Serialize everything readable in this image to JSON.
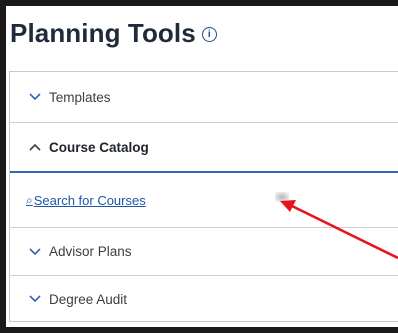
{
  "header": {
    "title": "Planning Tools",
    "info_icon": "info-icon"
  },
  "accordion": {
    "items": [
      {
        "label": "Templates",
        "state": "collapsed",
        "icon": "chevron-down-icon"
      },
      {
        "label": "Course Catalog",
        "state": "expanded",
        "icon": "chevron-up-icon"
      },
      {
        "label": "Advisor Plans",
        "state": "collapsed",
        "icon": "chevron-down-icon"
      },
      {
        "label": "Degree Audit",
        "state": "collapsed",
        "icon": "chevron-down-icon"
      }
    ],
    "course_catalog": {
      "link_label": "Search for Courses",
      "link_icon": "key-icon"
    }
  },
  "annotation": {
    "arrow_color": "#e8141b"
  },
  "colors": {
    "accent": "#2c66b4",
    "link": "#1d56a6",
    "title": "#1f2b3a"
  }
}
